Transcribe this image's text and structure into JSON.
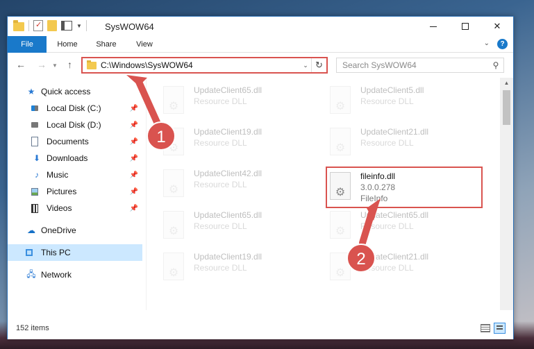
{
  "window": {
    "title": "SysWOW64"
  },
  "ribbon": {
    "tabs": [
      {
        "label": "File"
      },
      {
        "label": "Home"
      },
      {
        "label": "Share"
      },
      {
        "label": "View"
      }
    ]
  },
  "address": {
    "path": "C:\\Windows\\SysWOW64"
  },
  "search": {
    "placeholder": "Search SysWOW64"
  },
  "sidebar": {
    "items": [
      {
        "label": "Quick access",
        "icon": "star-icon"
      },
      {
        "label": "Local Disk (C:)",
        "icon": "drive-icon"
      },
      {
        "label": "Local Disk (D:)",
        "icon": "drive-icon"
      },
      {
        "label": "Documents",
        "icon": "documents-icon"
      },
      {
        "label": "Downloads",
        "icon": "downloads-icon"
      },
      {
        "label": "Music",
        "icon": "music-icon"
      },
      {
        "label": "Pictures",
        "icon": "pictures-icon"
      },
      {
        "label": "Videos",
        "icon": "videos-icon"
      },
      {
        "label": "OneDrive",
        "icon": "cloud-icon"
      },
      {
        "label": "This PC",
        "icon": "pc-icon",
        "selected": true
      },
      {
        "label": "Network",
        "icon": "network-icon"
      }
    ]
  },
  "files": [
    {
      "name": "UpdateClient65.dll",
      "sub": "Resource DLL"
    },
    {
      "name": "UpdateClient5.dll",
      "sub": "Resource DLL"
    },
    {
      "name": "UpdateClient19.dll",
      "sub": "Resource DLL"
    },
    {
      "name": "UpdateClient21.dll",
      "sub": "Resource DLL"
    },
    {
      "name": "UpdateClient42.dll",
      "sub": "Resource DLL"
    },
    {
      "name": "fileinfo.dll",
      "version": "3.0.0.278",
      "sub": "FileInfo"
    },
    {
      "name": "UpdateClient65.dll",
      "sub": "Resource DLL"
    },
    {
      "name": "UpdateClient65.dll",
      "sub": "Resource DLL"
    },
    {
      "name": "UpdateClient19.dll",
      "sub": "Resource DLL"
    },
    {
      "name": "UpdateClient21.dll",
      "sub": "Resource DLL"
    }
  ],
  "status": {
    "item_count": "152 items"
  },
  "annotations": {
    "step1": "1",
    "step2": "2",
    "color": "#d9534f"
  }
}
